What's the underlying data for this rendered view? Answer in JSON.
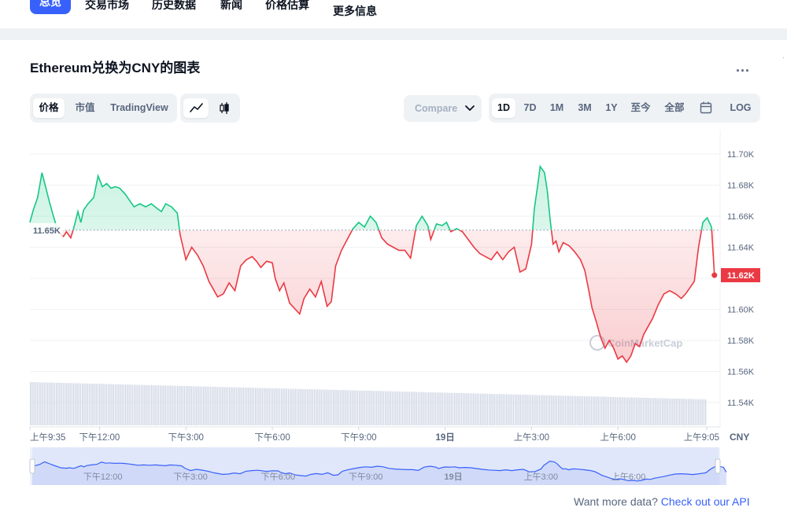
{
  "nav": {
    "items": [
      "总览",
      "交易市场",
      "历史数据",
      "新闻",
      "价格估算",
      "更多信息"
    ],
    "active_index": 0
  },
  "header": {
    "title": "Ethereum兑换为CNY的图表",
    "more": "..."
  },
  "view_tabs": [
    "价格",
    "市值",
    "TradingView"
  ],
  "chart_type_icons": [
    "line-chart-icon",
    "candlestick-icon"
  ],
  "compare": {
    "label": "Compare"
  },
  "range_tabs": [
    "1D",
    "7D",
    "1M",
    "3M",
    "1Y",
    "至今",
    "全部"
  ],
  "calendar_icon": "calendar-icon",
  "log_label": "LOG",
  "footer": {
    "text": "Want more data?",
    "link": "Check out our API"
  },
  "colors": {
    "up": "#16c784",
    "down": "#ea3943",
    "accent": "#3861fb",
    "nav_fill": "#dbe3fb"
  },
  "chart_data": {
    "type": "area",
    "currency": "CNY",
    "baseline": 11651,
    "baseline_label": "11.65K",
    "last_value": 11622,
    "last_label": "11.62K",
    "ylim": [
      11530,
      11720
    ],
    "y_ticks": [
      11700,
      11680,
      11660,
      11640,
      11620,
      11600,
      11580,
      11560,
      11540
    ],
    "y_tick_labels": [
      "11.70K",
      "11.68K",
      "11.66K",
      "11.64K",
      "11.62K",
      "11.60K",
      "11.58K",
      "11.56K",
      "11.54K"
    ],
    "x_range": [
      9.583,
      33.083
    ],
    "x_ticks": [
      9.583,
      12,
      15,
      18,
      21,
      24,
      27,
      30,
      33.083
    ],
    "x_tick_labels": [
      "上午9:35",
      "下午12:00",
      "下午3:00",
      "下午6:00",
      "下午9:00",
      "19日",
      "上午3:00",
      "上午6:00",
      "上午9:05"
    ],
    "navigator_ticks": [
      12,
      15,
      18,
      21,
      24,
      27,
      30
    ],
    "navigator_labels": [
      "下午12:00",
      "下午3:00",
      "下午6:00",
      "下午9:00",
      "19日",
      "上午3:00",
      "上午6:00"
    ],
    "watermark": "CoinMarketCap",
    "points": [
      [
        9.58,
        11656
      ],
      [
        9.7,
        11664
      ],
      [
        9.85,
        11672
      ],
      [
        10.0,
        11688
      ],
      [
        10.1,
        11681
      ],
      [
        10.25,
        11670
      ],
      [
        10.4,
        11660
      ],
      [
        10.45,
        11657
      ],
      [
        10.55,
        11650
      ],
      [
        10.75,
        11647
      ],
      [
        10.85,
        11650
      ],
      [
        11.0,
        11646
      ],
      [
        11.1,
        11652
      ],
      [
        11.25,
        11663
      ],
      [
        11.35,
        11656
      ],
      [
        11.45,
        11664
      ],
      [
        11.6,
        11668
      ],
      [
        11.8,
        11672
      ],
      [
        11.95,
        11686
      ],
      [
        12.1,
        11679
      ],
      [
        12.25,
        11681
      ],
      [
        12.4,
        11678
      ],
      [
        12.55,
        11679
      ],
      [
        12.7,
        11678
      ],
      [
        12.9,
        11674
      ],
      [
        13.05,
        11670
      ],
      [
        13.2,
        11666
      ],
      [
        13.4,
        11668
      ],
      [
        13.6,
        11666
      ],
      [
        13.8,
        11668
      ],
      [
        14.0,
        11665
      ],
      [
        14.15,
        11663
      ],
      [
        14.3,
        11668
      ],
      [
        14.5,
        11666
      ],
      [
        14.7,
        11662
      ],
      [
        14.8,
        11648
      ],
      [
        14.9,
        11640
      ],
      [
        15.0,
        11632
      ],
      [
        15.2,
        11640
      ],
      [
        15.4,
        11635
      ],
      [
        15.6,
        11628
      ],
      [
        15.8,
        11618
      ],
      [
        15.95,
        11613
      ],
      [
        16.1,
        11608
      ],
      [
        16.3,
        11610
      ],
      [
        16.5,
        11617
      ],
      [
        16.7,
        11612
      ],
      [
        16.9,
        11628
      ],
      [
        17.1,
        11632
      ],
      [
        17.3,
        11634
      ],
      [
        17.45,
        11631
      ],
      [
        17.6,
        11627
      ],
      [
        17.8,
        11631
      ],
      [
        18.0,
        11630
      ],
      [
        18.1,
        11620
      ],
      [
        18.25,
        11612
      ],
      [
        18.4,
        11617
      ],
      [
        18.6,
        11604
      ],
      [
        18.8,
        11600
      ],
      [
        18.95,
        11597
      ],
      [
        19.1,
        11607
      ],
      [
        19.3,
        11613
      ],
      [
        19.5,
        11608
      ],
      [
        19.7,
        11618
      ],
      [
        19.9,
        11602
      ],
      [
        20.05,
        11605
      ],
      [
        20.2,
        11628
      ],
      [
        20.4,
        11638
      ],
      [
        20.6,
        11645
      ],
      [
        20.8,
        11652
      ],
      [
        21.0,
        11656
      ],
      [
        21.2,
        11653
      ],
      [
        21.4,
        11660
      ],
      [
        21.6,
        11656
      ],
      [
        21.8,
        11646
      ],
      [
        22.0,
        11642
      ],
      [
        22.2,
        11640
      ],
      [
        22.4,
        11638
      ],
      [
        22.6,
        11638
      ],
      [
        22.8,
        11633
      ],
      [
        23.0,
        11654
      ],
      [
        23.2,
        11660
      ],
      [
        23.4,
        11654
      ],
      [
        23.5,
        11645
      ],
      [
        23.7,
        11655
      ],
      [
        23.9,
        11654
      ],
      [
        24.05,
        11656
      ],
      [
        24.2,
        11650
      ],
      [
        24.4,
        11652
      ],
      [
        24.6,
        11650
      ],
      [
        24.8,
        11645
      ],
      [
        25.0,
        11640
      ],
      [
        25.2,
        11636
      ],
      [
        25.4,
        11634
      ],
      [
        25.6,
        11632
      ],
      [
        25.8,
        11637
      ],
      [
        26.0,
        11632
      ],
      [
        26.2,
        11637
      ],
      [
        26.4,
        11640
      ],
      [
        26.6,
        11624
      ],
      [
        26.8,
        11626
      ],
      [
        27.0,
        11642
      ],
      [
        27.1,
        11665
      ],
      [
        27.2,
        11678
      ],
      [
        27.3,
        11692
      ],
      [
        27.45,
        11688
      ],
      [
        27.55,
        11676
      ],
      [
        27.65,
        11657
      ],
      [
        27.75,
        11642
      ],
      [
        27.85,
        11644
      ],
      [
        27.95,
        11637
      ],
      [
        28.1,
        11643
      ],
      [
        28.3,
        11641
      ],
      [
        28.5,
        11637
      ],
      [
        28.7,
        11632
      ],
      [
        28.85,
        11625
      ],
      [
        29.0,
        11611
      ],
      [
        29.1,
        11601
      ],
      [
        29.25,
        11592
      ],
      [
        29.4,
        11582
      ],
      [
        29.55,
        11575
      ],
      [
        29.7,
        11580
      ],
      [
        29.85,
        11575
      ],
      [
        30.0,
        11568
      ],
      [
        30.15,
        11570
      ],
      [
        30.3,
        11566
      ],
      [
        30.45,
        11570
      ],
      [
        30.6,
        11578
      ],
      [
        30.75,
        11576
      ],
      [
        30.9,
        11584
      ],
      [
        31.05,
        11589
      ],
      [
        31.2,
        11594
      ],
      [
        31.4,
        11603
      ],
      [
        31.6,
        11610
      ],
      [
        31.8,
        11612
      ],
      [
        32.0,
        11610
      ],
      [
        32.2,
        11607
      ],
      [
        32.35,
        11610
      ],
      [
        32.5,
        11614
      ],
      [
        32.65,
        11618
      ],
      [
        32.8,
        11640
      ],
      [
        32.95,
        11656
      ],
      [
        33.1,
        11659
      ],
      [
        33.25,
        11653
      ],
      [
        33.35,
        11622
      ]
    ]
  }
}
